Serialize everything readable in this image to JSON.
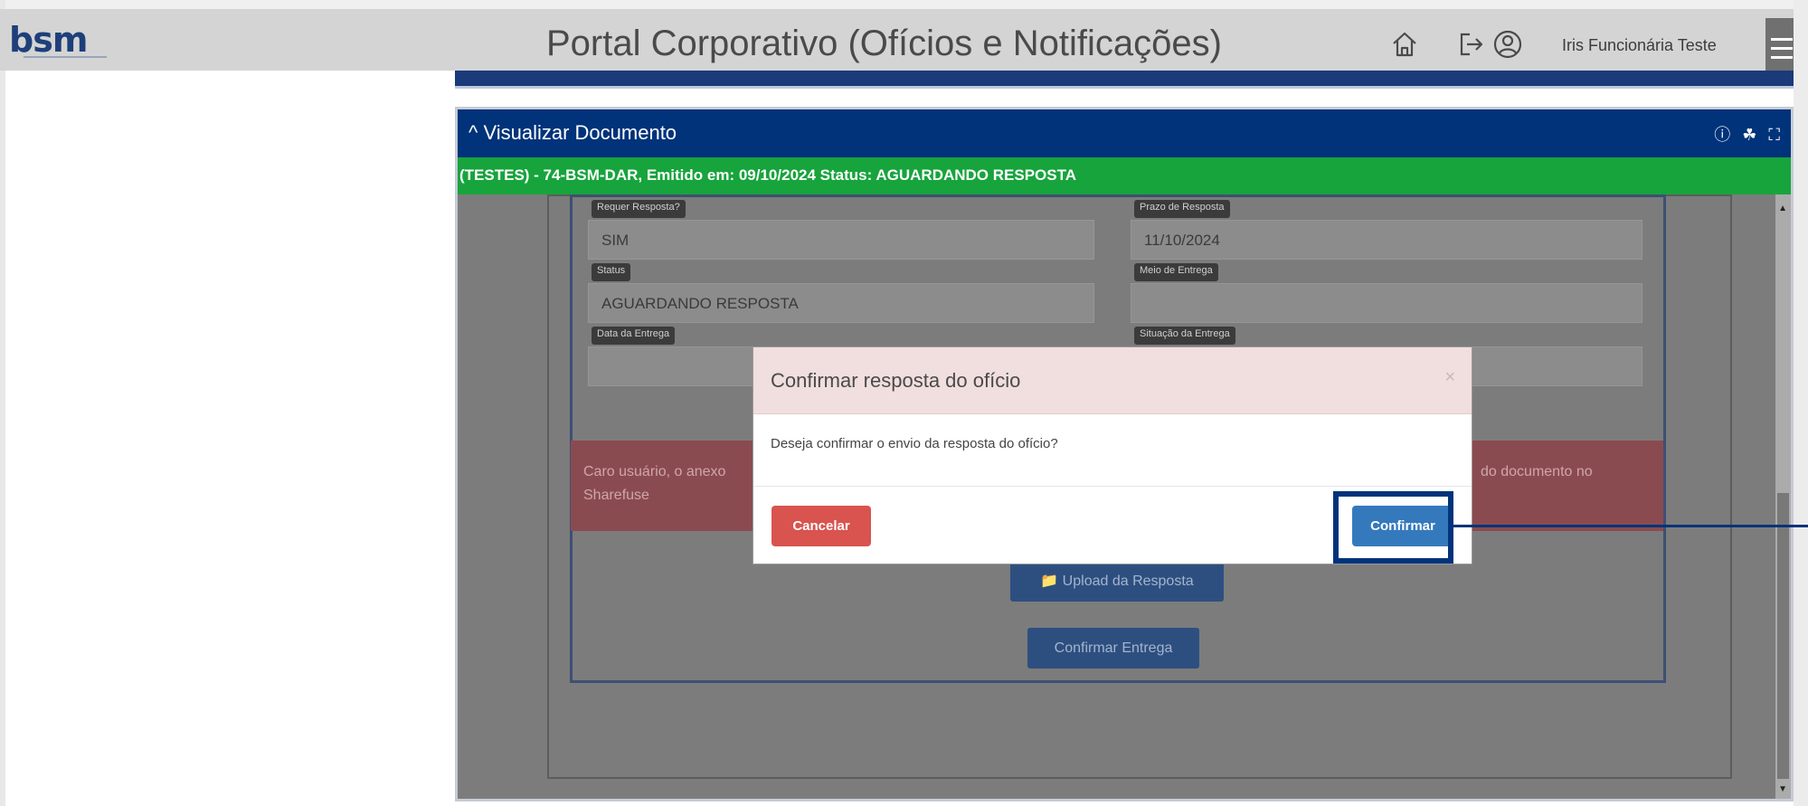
{
  "header": {
    "logo_text": "bsm",
    "title": "Portal Corporativo (Ofícios e Notificações)",
    "user_name": "Iris Funcionária Teste"
  },
  "panel": {
    "title": "Visualizar Documento",
    "toggle_glyph": "^",
    "tools": "ⓘ ☘ ⛶",
    "status_line": "(TESTES) - 74-BSM-DAR, Emitido em: 09/10/2024 Status: AGUARDANDO RESPOSTA"
  },
  "form": {
    "requer_resposta_label": "Requer Resposta?",
    "requer_resposta_value": "SIM",
    "prazo_label": "Prazo de Resposta",
    "prazo_value": "11/10/2024",
    "status_label": "Status",
    "status_value": "AGUARDANDO RESPOSTA",
    "meio_label": "Meio de Entrega",
    "meio_value": "",
    "data_entrega_label": "Data da Entrega",
    "data_entrega_value": "",
    "situacao_label": "Situação da Entrega",
    "situacao_value": ""
  },
  "alert": {
    "text_left": "Caro usuário, o anexo",
    "text_left2": "Sharefuse",
    "text_right": "do documento no"
  },
  "buttons": {
    "upload_label": "📁 Upload da Resposta",
    "confirmar_entrega_label": "Confirmar Entrega"
  },
  "modal": {
    "title": "Confirmar resposta do ofício",
    "close_glyph": "×",
    "body": "Deseja confirmar o envio da resposta do ofício?",
    "cancel_label": "Cancelar",
    "confirm_label": "Confirmar"
  },
  "colors": {
    "header_bg": "#d4d4d4",
    "panel_header": "#00337a",
    "status_green": "#17a43c",
    "cancel_red": "#d9534f",
    "confirm_blue": "#3579bd"
  }
}
